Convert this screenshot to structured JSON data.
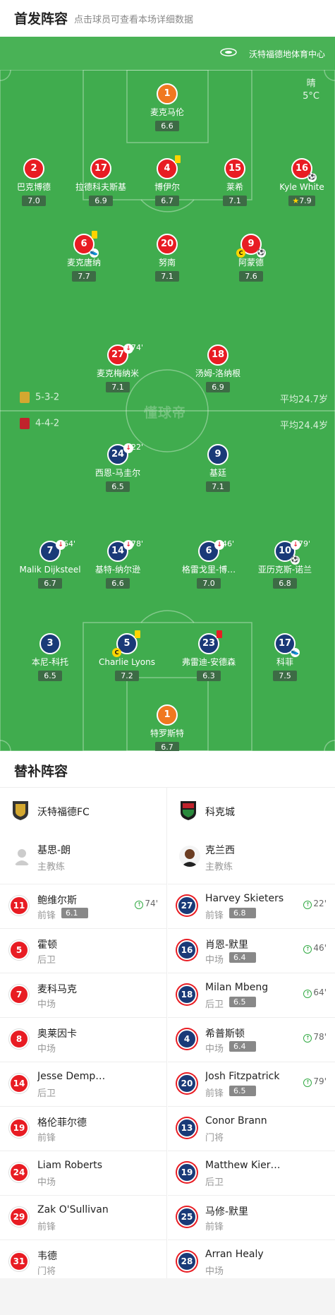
{
  "header": {
    "title": "首发阵容",
    "subtitle": "点击球员可查看本场详细数据"
  },
  "venue": "沃特福德地体育中心",
  "weather": {
    "condition": "晴",
    "temp": "5°C"
  },
  "watermark": "懂球帝",
  "home_form": {
    "formation": "5-3-2",
    "avg_age": "平均24.7岁"
  },
  "away_form": {
    "formation": "4-4-2",
    "avg_age": "平均24.4岁"
  },
  "home_players": [
    {
      "num": "1",
      "name": "麦克马伦",
      "rating": "6.6",
      "kit": "orange"
    },
    {
      "num": "2",
      "name": "巴克博德",
      "rating": "7.0",
      "kit": "red"
    },
    {
      "num": "17",
      "name": "拉德科夫斯基",
      "rating": "6.9",
      "kit": "red"
    },
    {
      "num": "4",
      "name": "博伊尔",
      "rating": "6.7",
      "kit": "red",
      "yellow": true
    },
    {
      "num": "15",
      "name": "莱希",
      "rating": "7.1",
      "kit": "red"
    },
    {
      "num": "16",
      "name": "Kyle White",
      "rating": "7.9",
      "kit": "red",
      "goal": true,
      "star": true
    },
    {
      "num": "6",
      "name": "麦克唐纳",
      "rating": "7.7",
      "kit": "red",
      "yellow": true,
      "assist": true
    },
    {
      "num": "20",
      "name": "努南",
      "rating": "7.1",
      "kit": "red"
    },
    {
      "num": "9",
      "name": "阿蒙德",
      "rating": "7.6",
      "kit": "red",
      "goal": true,
      "captain": true
    },
    {
      "num": "27",
      "name": "麦克梅纳米",
      "rating": "7.1",
      "kit": "red",
      "sub": "74'"
    },
    {
      "num": "18",
      "name": "汤姆-洛纳根",
      "rating": "6.9",
      "kit": "red"
    }
  ],
  "away_players": [
    {
      "num": "24",
      "name": "西恩-马圭尔",
      "rating": "6.5",
      "sub": "22'"
    },
    {
      "num": "9",
      "name": "基廷",
      "rating": "7.1"
    },
    {
      "num": "7",
      "name": "Malik Dijksteel",
      "rating": "6.7",
      "sub": "64'"
    },
    {
      "num": "14",
      "name": "基特-纳尔逊",
      "rating": "6.6",
      "sub": "78'"
    },
    {
      "num": "6",
      "name": "格雷戈里-博…",
      "rating": "7.0",
      "sub": "46'"
    },
    {
      "num": "10",
      "name": "亚历克斯-诺兰",
      "rating": "6.8",
      "sub": "79'",
      "goal": true
    },
    {
      "num": "3",
      "name": "本尼-科托",
      "rating": "6.5"
    },
    {
      "num": "5",
      "name": "Charlie Lyons",
      "rating": "7.2",
      "yellow": true,
      "captain": true
    },
    {
      "num": "23",
      "name": "弗雷迪-安德森",
      "rating": "6.3",
      "red": true
    },
    {
      "num": "17",
      "name": "科菲",
      "rating": "7.5",
      "assist": true
    },
    {
      "num": "1",
      "name": "特罗斯特",
      "rating": "6.7",
      "kit": "orange"
    }
  ],
  "subs": {
    "title": "替补阵容",
    "home": {
      "team": "沃特福德FC",
      "coach": {
        "name": "基思-朗",
        "role": "主教练"
      },
      "players": [
        {
          "num": "11",
          "name": "鲍维尔斯",
          "pos": "前锋",
          "rating": "6.1",
          "minute": "74'"
        },
        {
          "num": "5",
          "name": "霍顿",
          "pos": "后卫"
        },
        {
          "num": "7",
          "name": "麦科马克",
          "pos": "中场"
        },
        {
          "num": "8",
          "name": "奥莱因卡",
          "pos": "中场"
        },
        {
          "num": "14",
          "name": "Jesse Demp…",
          "pos": "后卫"
        },
        {
          "num": "19",
          "name": "格伦菲尔德",
          "pos": "前锋"
        },
        {
          "num": "24",
          "name": "Liam Roberts",
          "pos": "中场"
        },
        {
          "num": "29",
          "name": "Zak O'Sullivan",
          "pos": "前锋"
        },
        {
          "num": "31",
          "name": "韦德",
          "pos": "门将"
        }
      ]
    },
    "away": {
      "team": "科克城",
      "coach": {
        "name": "克兰西",
        "role": "主教练"
      },
      "players": [
        {
          "num": "27",
          "name": "Harvey Skieters",
          "pos": "前锋",
          "rating": "6.8",
          "minute": "22'"
        },
        {
          "num": "16",
          "name": "肖恩-默里",
          "pos": "中场",
          "rating": "6.4",
          "minute": "46'"
        },
        {
          "num": "18",
          "name": "Milan Mbeng",
          "pos": "后卫",
          "rating": "6.5",
          "minute": "64'"
        },
        {
          "num": "4",
          "name": "希普斯顿",
          "pos": "中场",
          "rating": "6.4",
          "minute": "78'"
        },
        {
          "num": "20",
          "name": "Josh Fitzpatrick",
          "pos": "前锋",
          "rating": "6.5",
          "minute": "79'"
        },
        {
          "num": "13",
          "name": "Conor Brann",
          "pos": "门将"
        },
        {
          "num": "19",
          "name": "Matthew Kier…",
          "pos": "后卫"
        },
        {
          "num": "25",
          "name": "马修-默里",
          "pos": "前锋"
        },
        {
          "num": "28",
          "name": "Arran Healy",
          "pos": "中场"
        }
      ]
    }
  },
  "colors": {
    "pitch": "#40ac4e",
    "home_kit": "#e81c23",
    "away_kit": "#1a3a78",
    "keeper_kit": "#f07820"
  }
}
